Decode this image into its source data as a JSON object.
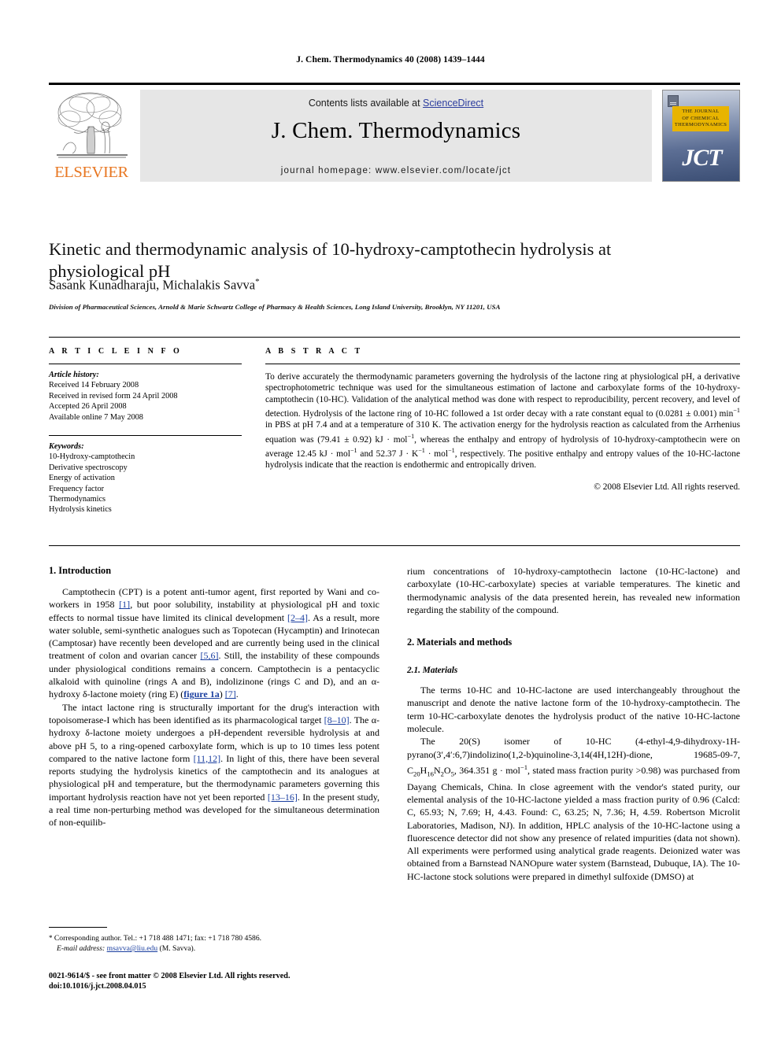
{
  "running_head": "J. Chem. Thermodynamics 40 (2008) 1439–1444",
  "masthead": {
    "contents_prefix": "Contents lists available at ",
    "sciencedirect": "ScienceDirect",
    "journal_name": "J. Chem. Thermodynamics",
    "homepage": "journal homepage: www.elsevier.com/locate/jct",
    "elsevier_wordmark": "ELSEVIER",
    "elsevier_color": "#E87722",
    "link_color": "#2b3c9e",
    "band_color": "#e6e6e6",
    "cover": {
      "title_line1": "THE JOURNAL",
      "title_line2": "OF CHEMICAL",
      "title_line3": "THERMODYNAMICS",
      "abbrev": "JCT",
      "title_box_color": "#E8B400"
    }
  },
  "article": {
    "title": "Kinetic and thermodynamic analysis of 10-hydroxy-camptothecin hydrolysis at physiological pH",
    "authors": "Sasank Kunadharaju, Michalakis Savva",
    "author_marker": "*",
    "affiliation": "Division of Pharmaceutical Sciences, Arnold & Marie Schwartz College of Pharmacy & Health Sciences, Long Island University, Brooklyn, NY 11201, USA"
  },
  "info": {
    "heading": "A R T I C L E    I N F O",
    "history_label": "Article history:",
    "history": [
      "Received 14 February 2008",
      "Received in revised form 24 April 2008",
      "Accepted 26 April 2008",
      "Available online 7 May 2008"
    ],
    "keywords_label": "Keywords:",
    "keywords": [
      "10-Hydroxy-camptothecin",
      "Derivative spectroscopy",
      "Energy of activation",
      "Frequency factor",
      "Thermodynamics",
      "Hydrolysis kinetics"
    ]
  },
  "abstract": {
    "heading": "A B S T R A C T",
    "body_part1": "To derive accurately the thermodynamic parameters governing the hydrolysis of the lactone ring at physiological pH, a derivative spectrophotometric technique was used for the simultaneous estimation of lactone and carboxylate forms of the 10-hydroxy-camptothecin (10-HC). Validation of the analytical method was done with respect to reproducibility, percent recovery, and level of detection. Hydrolysis of the lactone ring of 10-HC followed a 1st order decay with a rate constant equal to (0.0281 ± 0.001) min",
    "sup1": "−1",
    "body_part2": " in PBS at pH 7.4 and at a temperature of 310 K. The activation energy for the hydrolysis reaction as calculated from the Arrhenius equation was (79.41 ± 0.92) kJ · mol",
    "sup2": "−1",
    "body_part3": ", whereas the enthalpy and entropy of hydrolysis of 10-hydroxy-camptothecin were on average 12.45 kJ · mol",
    "sup3": "−1",
    "body_part4": " and 52.37 J · K",
    "sup4": "−1",
    "body_part5": " · mol",
    "sup5": "−1",
    "body_part6": ", respectively. The positive enthalpy and entropy values of the 10-HC-lactone hydrolysis indicate that the reaction is endothermic and entropically driven.",
    "copyright": "© 2008 Elsevier Ltd. All rights reserved."
  },
  "body": {
    "left": {
      "section1_heading": "1. Introduction",
      "p1_a": "Camptothecin (CPT) is a potent anti-tumor agent, first reported by Wani and co-workers in 1958 ",
      "p1_r1": "[1]",
      "p1_b": ", but poor solubility, instability at physiological pH and toxic effects to normal tissue have limited its clinical development ",
      "p1_r2": "[2–4]",
      "p1_c": ". As a result, more water soluble, semi-synthetic analogues such as Topotecan (Hycamptin) and Irinotecan (Camptosar) have recently been developed and are currently being used in the clinical treatment of colon and ovarian cancer ",
      "p1_r3": "[5,6]",
      "p1_d": ". Still, the instability of these compounds under physiological conditions remains a concern. Camptothecin is a pentacyclic alkaloid with quinoline (rings A and B), indolizinone (rings C and D), and an α-hydroxy δ-lactone moiety (ring E) (",
      "p1_r4": "figure 1a",
      "p1_e": ") ",
      "p1_r5": "[7]",
      "p1_f": ".",
      "p2_a": "The intact lactone ring is structurally important for the drug's interaction with topoisomerase-I which has been identified as its pharmacological target ",
      "p2_r1": "[8–10]",
      "p2_b": ". The α-hydroxy δ-lactone moiety undergoes a pH-dependent reversible hydrolysis at and above pH 5, to a ring-opened carboxylate form, which is up to 10 times less potent compared to the native lactone form ",
      "p2_r2": "[11,12]",
      "p2_c": ". In light of this, there have been several reports studying the hydrolysis kinetics of the camptothecin and its analogues at physiological pH and temperature, but the thermodynamic parameters governing this important hydrolysis reaction have not yet been reported ",
      "p2_r3": "[13–16]",
      "p2_d": ". In the present study, a real time non-perturbing method was developed for the simultaneous determination of non-equilib-"
    },
    "right": {
      "p1": "rium concentrations of 10-hydroxy-camptothecin lactone (10-HC-lactone) and carboxylate (10-HC-carboxylate) species at variable temperatures. The kinetic and thermodynamic analysis of the data presented herein, has revealed new information regarding the stability of the compound.",
      "section2_heading": "2. Materials and methods",
      "subsection21_heading": "2.1. Materials",
      "p2": "The terms 10-HC and 10-HC-lactone are used interchangeably throughout the manuscript and denote the native lactone form of the 10-hydroxy-camptothecin. The term 10-HC-carboxylate denotes the hydrolysis product of the native 10-HC-lactone molecule.",
      "p3_a": "The 20(S) isomer of 10-HC (4-ethyl-4,9-dihydroxy-1H-pyrano(3′,4′:6,7)indolizino(1,2-b)quinoline-3,14(4H,12H)-dione, 19685-09-7, C",
      "p3_sub1": "20",
      "p3_b": "H",
      "p3_sub2": "16",
      "p3_c": "N",
      "p3_sub3": "2",
      "p3_d": "O",
      "p3_sub4": "5",
      "p3_e": ", 364.351 g · mol",
      "p3_sup1": "−1",
      "p3_f": ", stated mass fraction purity >0.98) was purchased from Dayang Chemicals, China. In close agreement with the vendor's stated purity, our elemental analysis of the 10-HC-lactone yielded a mass fraction purity of 0.96 (Calcd: C, 65.93; N, 7.69; H, 4.43. Found: C, 63.25; N, 7.36; H, 4.59. Robertson Microlit Laboratories, Madison, NJ). In addition, HPLC analysis of the 10-HC-lactone using a fluorescence detector did not show any presence of related impurities (data not shown). All experiments were performed using analytical grade reagents. Deionized water was obtained from a Barnstead NANOpure water system (Barnstead, Dubuque, IA). The 10-HC-lactone stock solutions were prepared in dimethyl sulfoxide (DMSO) at"
    }
  },
  "footnote": {
    "marker": "*",
    "corresponding": "Corresponding author. Tel.: +1 718 488 1471; fax: +1 718 780 4586.",
    "email_label": "E-mail address:",
    "email": "msavva@liu.edu",
    "email_suffix": " (M. Savva).",
    "email_color": "#1b3fa0"
  },
  "imprint": {
    "line1": "0021-9614/$ - see front matter © 2008 Elsevier Ltd. All rights reserved.",
    "line2": "doi:10.1016/j.jct.2008.04.015"
  }
}
